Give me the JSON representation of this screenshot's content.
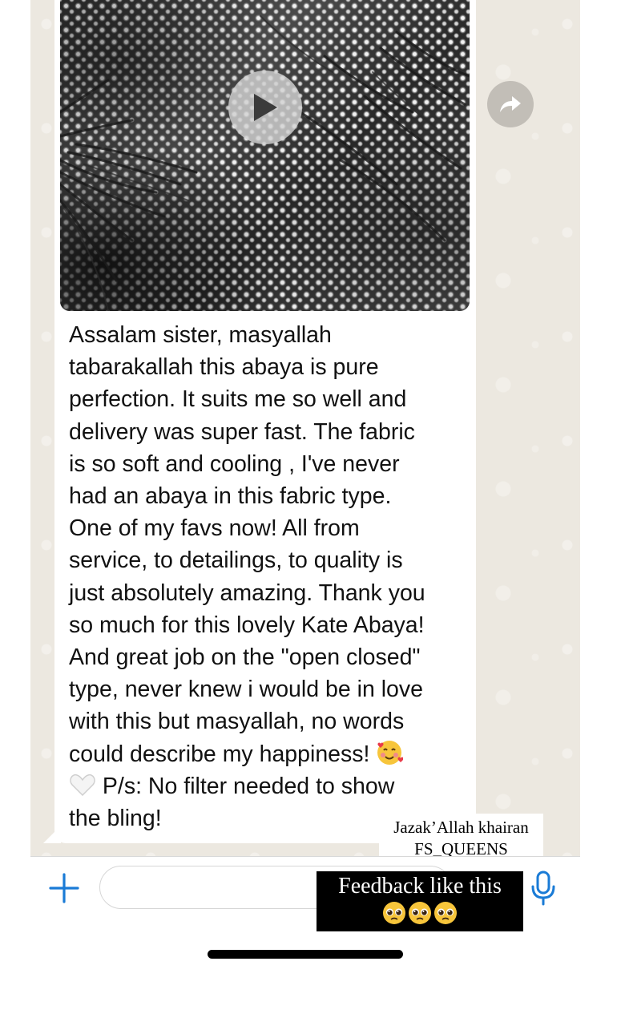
{
  "conversation": {
    "video_message": {
      "play_icon": "play-icon",
      "forward_icon": "forward-arrow-icon"
    },
    "message_text": "Assalam sister, masyallah\ntabarakallah this abaya is pure\nperfection. It suits me so well and\ndelivery was super fast. The fabric\nis so soft and cooling , I've never\nhad an abaya in this fabric type.\nOne of my favs now! All from\nservice, to detailings, to quality is\njust absolutely amazing. Thank you\nso much for this lovely Kate Abaya!\nAnd great job on the \"open closed\"\ntype, never knew i would be in love\nwith this but masyallah, no words\ncould describe my happiness!",
    "message_emojis": [
      "smiling-face-with-hearts-icon",
      "white-heart-icon"
    ],
    "message_text_end": "P/s: No filter needed to show\nthe bling!"
  },
  "overlays": {
    "thanks_line1": "Jazak’Allah khairan",
    "thanks_line2": "FS_QUEENS",
    "feedback_text": "Feedback like this",
    "feedback_emojis": [
      "pleading-face-icon",
      "pleading-face-icon",
      "pleading-face-icon"
    ]
  },
  "input_bar": {
    "plus_icon": "plus-icon",
    "message_placeholder": "",
    "mic_icon": "microphone-icon"
  },
  "colors": {
    "chat_background": "#ece8e0",
    "bubble": "#ffffff",
    "accent_blue": "#1a7bd6",
    "text": "#111111"
  }
}
